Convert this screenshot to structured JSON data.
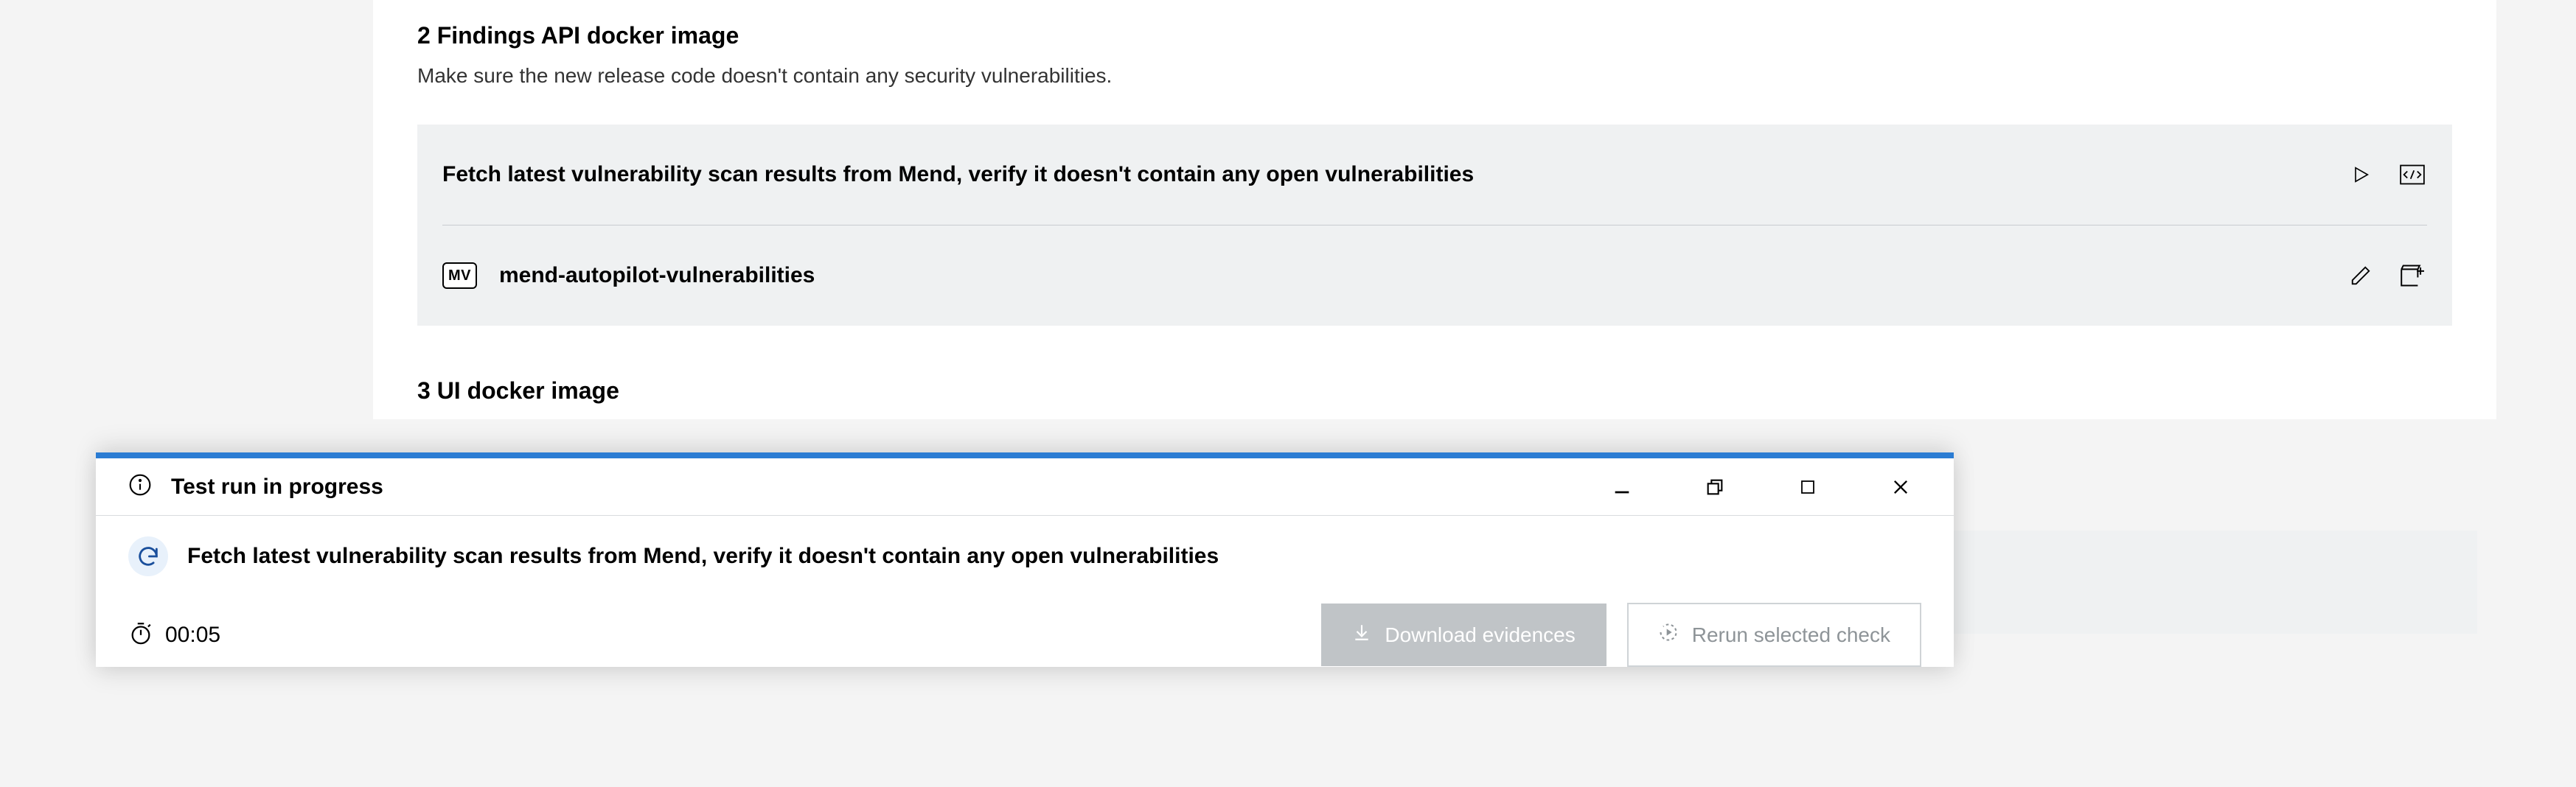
{
  "sections": [
    {
      "index": "2",
      "title": "Findings API docker image",
      "description": "Make sure the new release code doesn't contain any security vulnerabilities.",
      "check": {
        "title": "Fetch latest vulnerability scan results from Mend, verify it doesn't contain any open vulnerabilities",
        "autopilot_badge": "MV",
        "autopilot_name": "mend-autopilot-vulnerabilities"
      }
    },
    {
      "index": "3",
      "title": "UI docker image"
    }
  ],
  "panel": {
    "status_title": "Test run in progress",
    "running_check": "Fetch latest vulnerability scan results from Mend, verify it doesn't contain any open vulnerabilities",
    "timer": "00:05",
    "download_label": "Download evidences",
    "rerun_label": "Rerun selected check"
  }
}
